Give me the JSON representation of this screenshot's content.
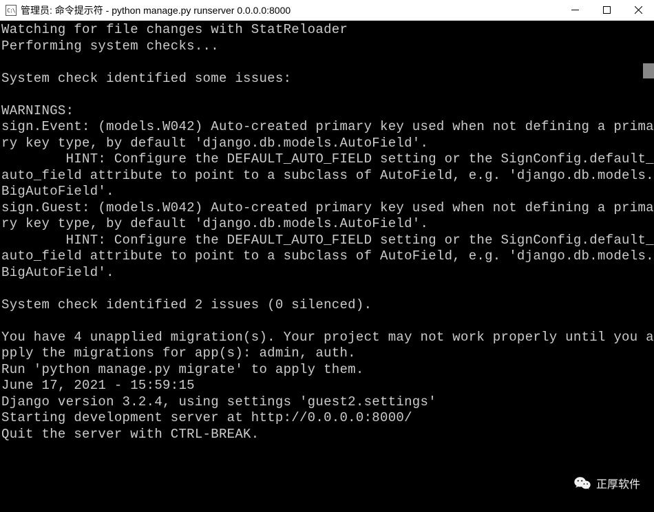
{
  "titlebar": {
    "icon_label": "C:\\",
    "title": "管理员: 命令提示符 - python  manage.py runserver 0.0.0.0:8000"
  },
  "terminal": {
    "lines": [
      "Watching for file changes with StatReloader",
      "Performing system checks...",
      "",
      "System check identified some issues:",
      "",
      "WARNINGS:",
      "sign.Event: (models.W042) Auto-created primary key used when not defining a primary key type, by default 'django.db.models.AutoField'.",
      "        HINT: Configure the DEFAULT_AUTO_FIELD setting or the SignConfig.default_auto_field attribute to point to a subclass of AutoField, e.g. 'django.db.models.BigAutoField'.",
      "sign.Guest: (models.W042) Auto-created primary key used when not defining a primary key type, by default 'django.db.models.AutoField'.",
      "        HINT: Configure the DEFAULT_AUTO_FIELD setting or the SignConfig.default_auto_field attribute to point to a subclass of AutoField, e.g. 'django.db.models.BigAutoField'.",
      "",
      "System check identified 2 issues (0 silenced).",
      "",
      "You have 4 unapplied migration(s). Your project may not work properly until you apply the migrations for app(s): admin, auth.",
      "Run 'python manage.py migrate' to apply them.",
      "June 17, 2021 - 15:59:15",
      "Django version 3.2.4, using settings 'guest2.settings'",
      "Starting development server at http://0.0.0.0:8000/",
      "Quit the server with CTRL-BREAK."
    ]
  },
  "watermark": {
    "text": "正厚软件"
  }
}
